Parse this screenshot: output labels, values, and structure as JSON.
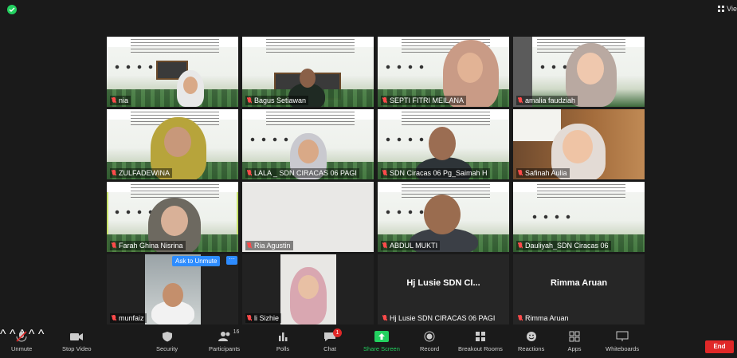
{
  "view_label": "Vie",
  "participants": [
    {
      "name": "nia"
    },
    {
      "name": "Bagus Setiawan"
    },
    {
      "name": "SEPTI FITRI MEILANA"
    },
    {
      "name": "amalia faudziah"
    },
    {
      "name": "ZULFADEWINA"
    },
    {
      "name": "LALA _ SDN CIRACAS 06 PAGI"
    },
    {
      "name": "SDN Ciracas 06 Pg_Saimah H"
    },
    {
      "name": "Safinah Aulia"
    },
    {
      "name": "Farah Ghina Nisrina"
    },
    {
      "name": "Ria Agustin"
    },
    {
      "name": "ABDUL MUKTI"
    },
    {
      "name": "Dauliyah_SDN Ciracas 06"
    },
    {
      "name": "munfaiz"
    },
    {
      "name": "li Sizhie"
    },
    {
      "name": "Hj Lusie SDN CIRACAS 06 PAGI",
      "display": "Hj Lusie SDN CI..."
    },
    {
      "name": "Rimma Aruan",
      "display": "Rimma Aruan"
    }
  ],
  "overlay": {
    "ask_to_unmute": "Ask to Unmute",
    "more": "···"
  },
  "toolbar": {
    "unmute": "Unmute",
    "stop_video": "Stop Video",
    "security": "Security",
    "participants": "Participants",
    "participants_count": "16",
    "polls": "Polls",
    "chat": "Chat",
    "chat_badge": "1",
    "share_screen": "Share Screen",
    "record": "Record",
    "breakout_rooms": "Breakout Rooms",
    "reactions": "Reactions",
    "apps": "Apps",
    "whiteboards": "Whiteboards",
    "end": "End"
  },
  "colors": {
    "accent": "#2d8cff",
    "share": "#23d160",
    "end": "#e02828",
    "active_speaker": "#c7e26a"
  }
}
